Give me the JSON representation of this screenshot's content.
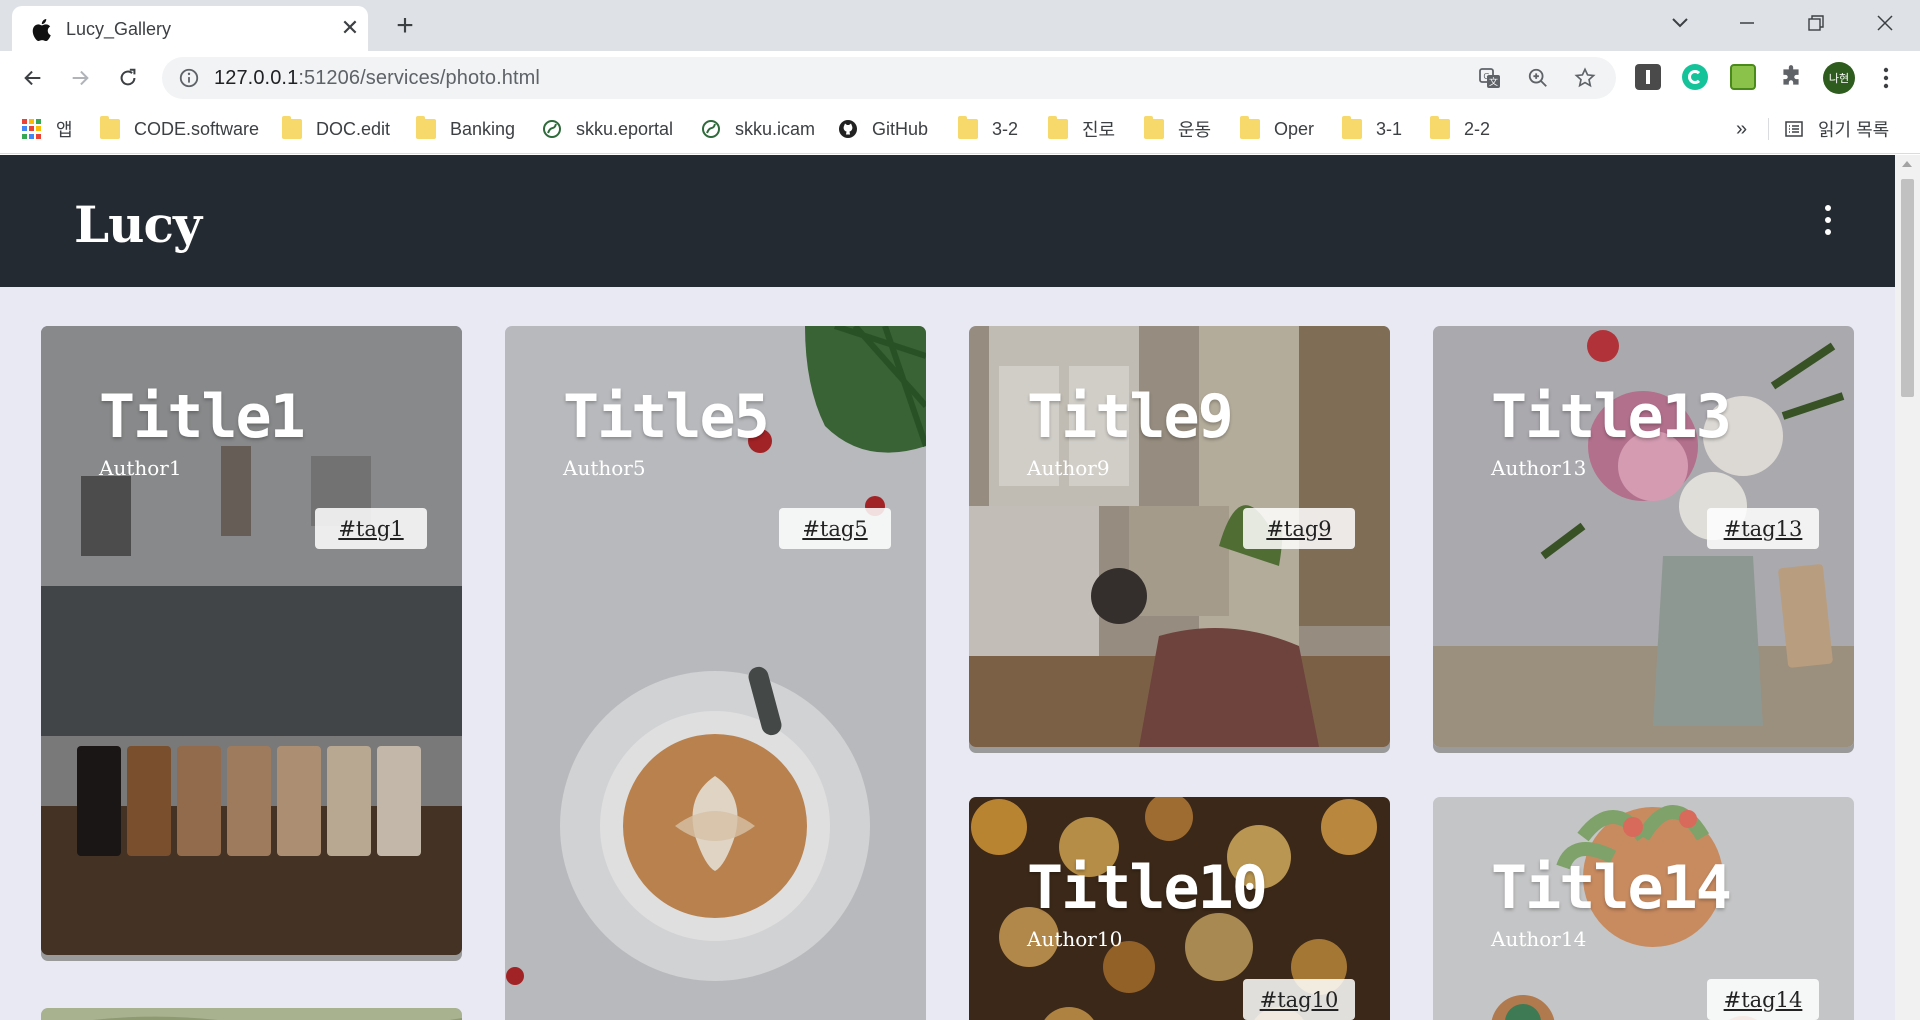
{
  "browser": {
    "tab_title": "Lucy_Gallery",
    "url_host": "127.0.0.1",
    "url_path": ":51206/services/photo.html",
    "profile_label": "나현",
    "bookmarks": [
      {
        "label": "앱",
        "icon": "apps-icon"
      },
      {
        "label": "CODE.software",
        "icon": "folder-icon"
      },
      {
        "label": "DOC.edit",
        "icon": "folder-icon"
      },
      {
        "label": "Banking",
        "icon": "folder-icon"
      },
      {
        "label": "skku.eportal",
        "icon": "skku-icon"
      },
      {
        "label": "skku.icam",
        "icon": "skku-icon"
      },
      {
        "label": "GitHub",
        "icon": "github-icon"
      },
      {
        "label": "3-2",
        "icon": "folder-icon"
      },
      {
        "label": "진로",
        "icon": "folder-icon"
      },
      {
        "label": "운동",
        "icon": "folder-icon"
      },
      {
        "label": "Oper",
        "icon": "folder-icon"
      },
      {
        "label": "3-1",
        "icon": "folder-icon"
      },
      {
        "label": "2-2",
        "icon": "folder-icon"
      }
    ],
    "overflow_label": "»",
    "reading_list_label": "읽기 목록"
  },
  "site": {
    "logo": "Lucy"
  },
  "cards": [
    {
      "title": "Title1",
      "author": "Author1",
      "tag": "#tag1"
    },
    {
      "title": "Title5",
      "author": "Author5",
      "tag": "#tag5"
    },
    {
      "title": "Title9",
      "author": "Author9",
      "tag": "#tag9"
    },
    {
      "title": "Title13",
      "author": "Author13",
      "tag": "#tag13"
    },
    {
      "title": "Title10",
      "author": "Author10",
      "tag": "#tag10"
    },
    {
      "title": "Title14",
      "author": "Author14",
      "tag": "#tag14"
    }
  ],
  "colors": {
    "header_bg": "#232a31",
    "page_bg": "#e9e9f4",
    "chrome_bg": "#dee1e6"
  }
}
